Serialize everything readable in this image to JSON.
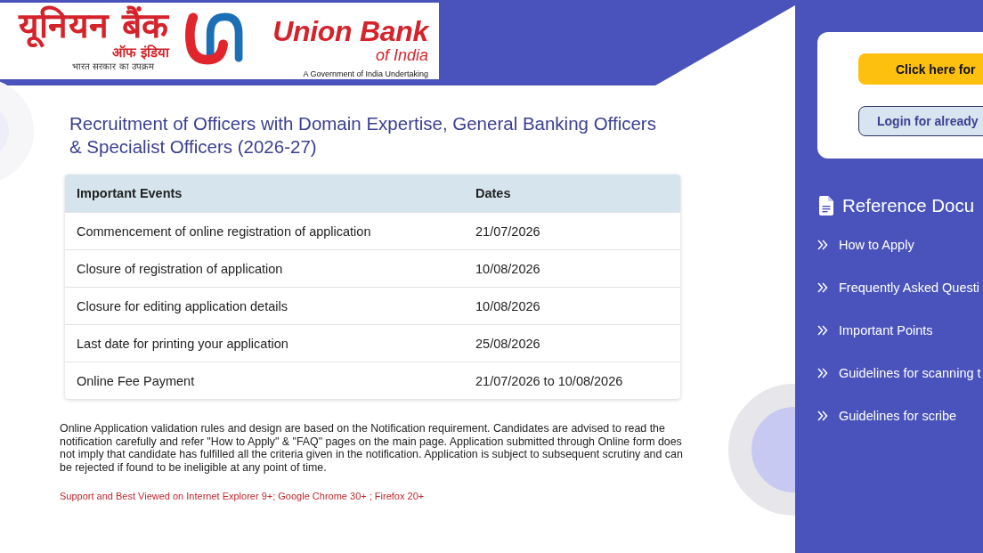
{
  "header": {
    "logo": {
      "hindi_name": "यूनियन बैंक",
      "hindi_subname": "ऑफ इंडिया",
      "hindi_tagline": "भारत सरकार का उपक्रम",
      "name": "Union Bank",
      "subname": "of India",
      "tagline": "A Government of India Undertaking"
    }
  },
  "main": {
    "title": "Recruitment of Officers with Domain Expertise, General Banking Officers & Specialist Officers (2026-27)",
    "table": {
      "columns": [
        "Important Events",
        "Dates"
      ],
      "rows": [
        {
          "event": "Commencement of online registration of application",
          "date": "21/07/2026"
        },
        {
          "event": "Closure of registration of application",
          "date": "10/08/2026"
        },
        {
          "event": "Closure for editing application details",
          "date": "10/08/2026"
        },
        {
          "event": "Last date for printing your application",
          "date": "25/08/2026"
        },
        {
          "event": "Online Fee Payment",
          "date": "21/07/2026 to 10/08/2026"
        }
      ]
    },
    "notice": "Online Application validation rules and design are based on the Notification requirement. Candidates are advised to read the notification carefully and refer \"How to Apply\" & \"FAQ\" pages on the main page. Application submitted through Online form does not imply that candidate has fulfilled all the criteria given in the notification. Application is subject to subsequent scrutiny and can be rejected if found to be ineligible at any point of time.",
    "browser_support": "Support and Best Viewed on Internet Explorer 9+; Google Chrome 30+ ; Firefox 20+"
  },
  "sidebar": {
    "buttons": [
      {
        "label": "Click here for",
        "kind": "primary"
      },
      {
        "label": "Login for already",
        "kind": "secondary"
      }
    ],
    "reference": {
      "heading": "Reference Docu",
      "items": [
        "How to Apply",
        "Frequently Asked Questi",
        "Important Points",
        "Guidelines for scanning t",
        "Guidelines for scribe"
      ]
    }
  }
}
